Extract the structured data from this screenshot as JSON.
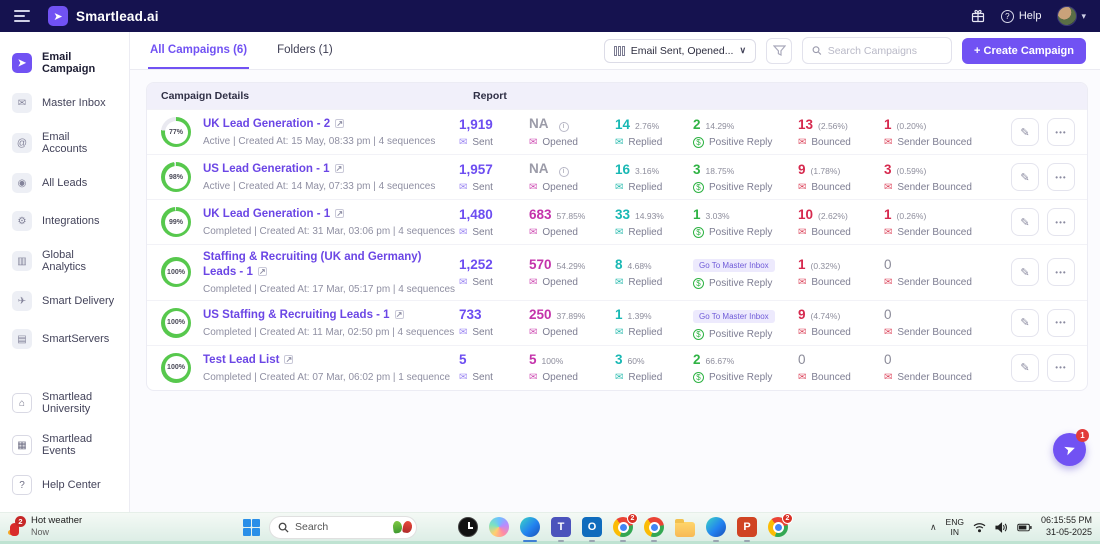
{
  "header": {
    "brand": "Smartlead.ai",
    "help": "Help"
  },
  "icons": {
    "megaphone": "➤",
    "inbox": "✉",
    "email": "@",
    "leads": "◉",
    "integrations": "⚙",
    "analytics": "▥",
    "delivery": "✈",
    "servers": "▤",
    "university": "⌂",
    "events": "▦",
    "helpbook": "?",
    "pencil": "✎",
    "dots": "•••",
    "external": "↗",
    "info": "i",
    "envelope": "✉",
    "dollar": "$",
    "chevron_down": "▾",
    "chevron_up": "∧",
    "dd_chevron": "∨"
  },
  "sidebar": {
    "items": [
      {
        "label": "Email Campaign"
      },
      {
        "label": "Master Inbox"
      },
      {
        "label": "Email Accounts"
      },
      {
        "label": "All Leads"
      },
      {
        "label": "Integrations"
      },
      {
        "label": "Global Analytics"
      },
      {
        "label": "Smart Delivery"
      },
      {
        "label": "SmartServers"
      }
    ],
    "footer": [
      {
        "label": "Smartlead University"
      },
      {
        "label": "Smartlead Events"
      },
      {
        "label": "Help Center"
      }
    ]
  },
  "toolbar": {
    "tab_all": "All Campaigns (6)",
    "tab_folders": "Folders (1)",
    "columns_selected": "Email Sent, Opened...",
    "search_placeholder": "Search Campaigns",
    "create": "+ Create Campaign"
  },
  "table": {
    "header_campaign": "Campaign Details",
    "header_report": "Report",
    "labels": {
      "sent": "Sent",
      "opened": "Opened",
      "replied": "Replied",
      "positive": "Positive Reply",
      "bounced": "Bounced",
      "sender": "Sender Bounced"
    },
    "master_inbox_pill": "Go To Master Inbox",
    "rows": [
      {
        "progress": "77%",
        "name": "UK Lead Generation - 2",
        "meta": "Active | Created At: 15 May, 08:33 pm | 4 sequences",
        "sent": "1,919",
        "opened": "NA",
        "opened_pct": "",
        "replied": "14",
        "replied_pct": "2.76%",
        "positive": "2",
        "positive_pct": "14.29%",
        "positive_pill": false,
        "bounced": "13",
        "bounced_pct": "(2.56%)",
        "sender": "1",
        "sender_pct": "(0.20%)"
      },
      {
        "progress": "98%",
        "name": "US Lead Generation - 1",
        "meta": "Active | Created At: 14 May, 07:33 pm | 4 sequences",
        "sent": "1,957",
        "opened": "NA",
        "opened_pct": "",
        "replied": "16",
        "replied_pct": "3.16%",
        "positive": "3",
        "positive_pct": "18.75%",
        "positive_pill": false,
        "bounced": "9",
        "bounced_pct": "(1.78%)",
        "sender": "3",
        "sender_pct": "(0.59%)"
      },
      {
        "progress": "99%",
        "name": "UK Lead Generation - 1",
        "meta": "Completed | Created At: 31 Mar, 03:06 pm | 4 sequences",
        "sent": "1,480",
        "opened": "683",
        "opened_pct": "57.85%",
        "replied": "33",
        "replied_pct": "14.93%",
        "positive": "1",
        "positive_pct": "3.03%",
        "positive_pill": false,
        "bounced": "10",
        "bounced_pct": "(2.62%)",
        "sender": "1",
        "sender_pct": "(0.26%)"
      },
      {
        "progress": "100%",
        "name": "Staffing & Recruiting (UK and Germany) Leads - 1",
        "meta": "Completed | Created At: 17 Mar, 05:17 pm | 4 sequences",
        "sent": "1,252",
        "opened": "570",
        "opened_pct": "54.29%",
        "replied": "8",
        "replied_pct": "4.68%",
        "positive": "",
        "positive_pct": "",
        "positive_pill": true,
        "bounced": "1",
        "bounced_pct": "(0.32%)",
        "sender": "0",
        "sender_pct": ""
      },
      {
        "progress": "100%",
        "name": "US Staffing & Recruiting Leads - 1",
        "meta": "Completed | Created At: 11 Mar, 02:50 pm | 4 sequences",
        "sent": "733",
        "opened": "250",
        "opened_pct": "37.89%",
        "replied": "1",
        "replied_pct": "1.39%",
        "positive": "",
        "positive_pct": "",
        "positive_pill": true,
        "bounced": "9",
        "bounced_pct": "(4.74%)",
        "sender": "0",
        "sender_pct": ""
      },
      {
        "progress": "100%",
        "name": "Test Lead List",
        "meta": "Completed | Created At: 07 Mar, 06:02 pm | 1 sequence",
        "sent": "5",
        "opened": "5",
        "opened_pct": "100%",
        "replied": "3",
        "replied_pct": "60%",
        "positive": "2",
        "positive_pct": "66.67%",
        "positive_pill": false,
        "bounced": "0",
        "bounced_pct": "",
        "sender": "0",
        "sender_pct": ""
      }
    ]
  },
  "fab": {
    "badge": "1"
  },
  "taskbar": {
    "weather_title": "Hot weather",
    "weather_sub": "Now",
    "weather_badge": "2",
    "search": "Search",
    "lang_1": "ENG",
    "lang_2": "IN",
    "time": "06:15:55 PM",
    "date": "31-05-2025",
    "badge_a": "2",
    "badge_b": "2"
  }
}
